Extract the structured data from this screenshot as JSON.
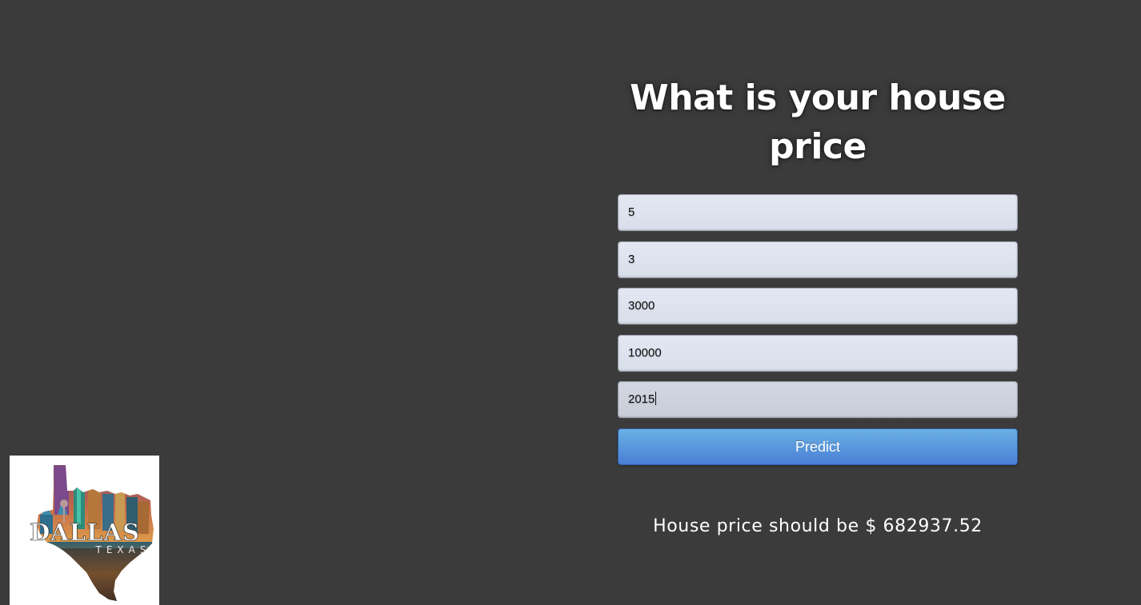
{
  "page": {
    "title": "What is your house price"
  },
  "form": {
    "fields": [
      {
        "value": "5"
      },
      {
        "value": "3"
      },
      {
        "value": "3000"
      },
      {
        "value": "10000"
      },
      {
        "value": "2015"
      }
    ],
    "submit_label": "Predict"
  },
  "result": {
    "text": "House price should be $ 682937.52"
  },
  "logo": {
    "title_text": "DALLAS",
    "subtitle_text": "TEXAS"
  },
  "colors": {
    "background": "#3b3b3b",
    "button": "#4a7fd6",
    "field": "#dde2ee"
  }
}
